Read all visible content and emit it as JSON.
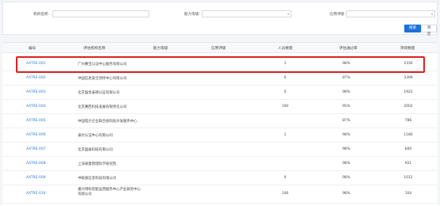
{
  "filters": {
    "org_name_label": "机构名称:",
    "ability_label": "能力等级:",
    "credit_label": "信用评级:",
    "search_label": "搜索",
    "reset_label": "清空"
  },
  "table": {
    "headers": [
      "编号",
      "评估机构名称",
      "能力等级",
      "信用评级",
      "人员数量",
      "评估通过率",
      "项目数量"
    ],
    "rows": [
      {
        "code": "AXTRE-001",
        "name": "广州赛宝认证中心服务有限公司",
        "level": "",
        "credit": "",
        "staff": "1",
        "rate": "98%",
        "projects": "2336"
      },
      {
        "code": "AXTRE-002",
        "name": "中国信息安全测评中心有限公司",
        "level": "",
        "credit": "",
        "staff": "0",
        "rate": "87%",
        "projects": "3399"
      },
      {
        "code": "AXTRE-003",
        "name": "北京国金泰德认证有限公司",
        "level": "",
        "credit": "",
        "staff": "0",
        "rate": "98%",
        "projects": "1923"
      },
      {
        "code": "AXTRE-004",
        "name": "北京赛西科技发展有限责任公司",
        "level": "",
        "credit": "",
        "staff": "100",
        "rate": "95%",
        "projects": "2002"
      },
      {
        "code": "AXTRE-005",
        "name": "中国电力企业联合会科技开发服务中心",
        "level": "",
        "credit": "",
        "staff": "",
        "rate": "87%",
        "projects": "786"
      },
      {
        "code": "AXTRE-006",
        "name": "泰尔认证中心有限公司",
        "level": "",
        "credit": "",
        "staff": "1",
        "rate": "98%",
        "projects": "1180"
      },
      {
        "code": "AXTRE-007",
        "name": "北京国泰科技有限公司",
        "level": "",
        "credit": "",
        "staff": "",
        "rate": "98%",
        "projects": "800"
      },
      {
        "code": "AXTRE-008",
        "name": "上海质量管理科学研究院",
        "level": "",
        "credit": "",
        "staff": "",
        "rate": "98%",
        "projects": "921"
      },
      {
        "code": "AXTRE-009",
        "name": "中联质信息科技有限公司",
        "level": "",
        "credit": "",
        "staff": "0",
        "rate": "98%",
        "projects": "1012"
      },
      {
        "code": "AXTRE-010",
        "name": "嘉兴博科智能运营服务中心产业研究中心有限公司",
        "level": "",
        "credit": "",
        "staff": "106",
        "rate": "98%",
        "projects": "104"
      }
    ]
  }
}
